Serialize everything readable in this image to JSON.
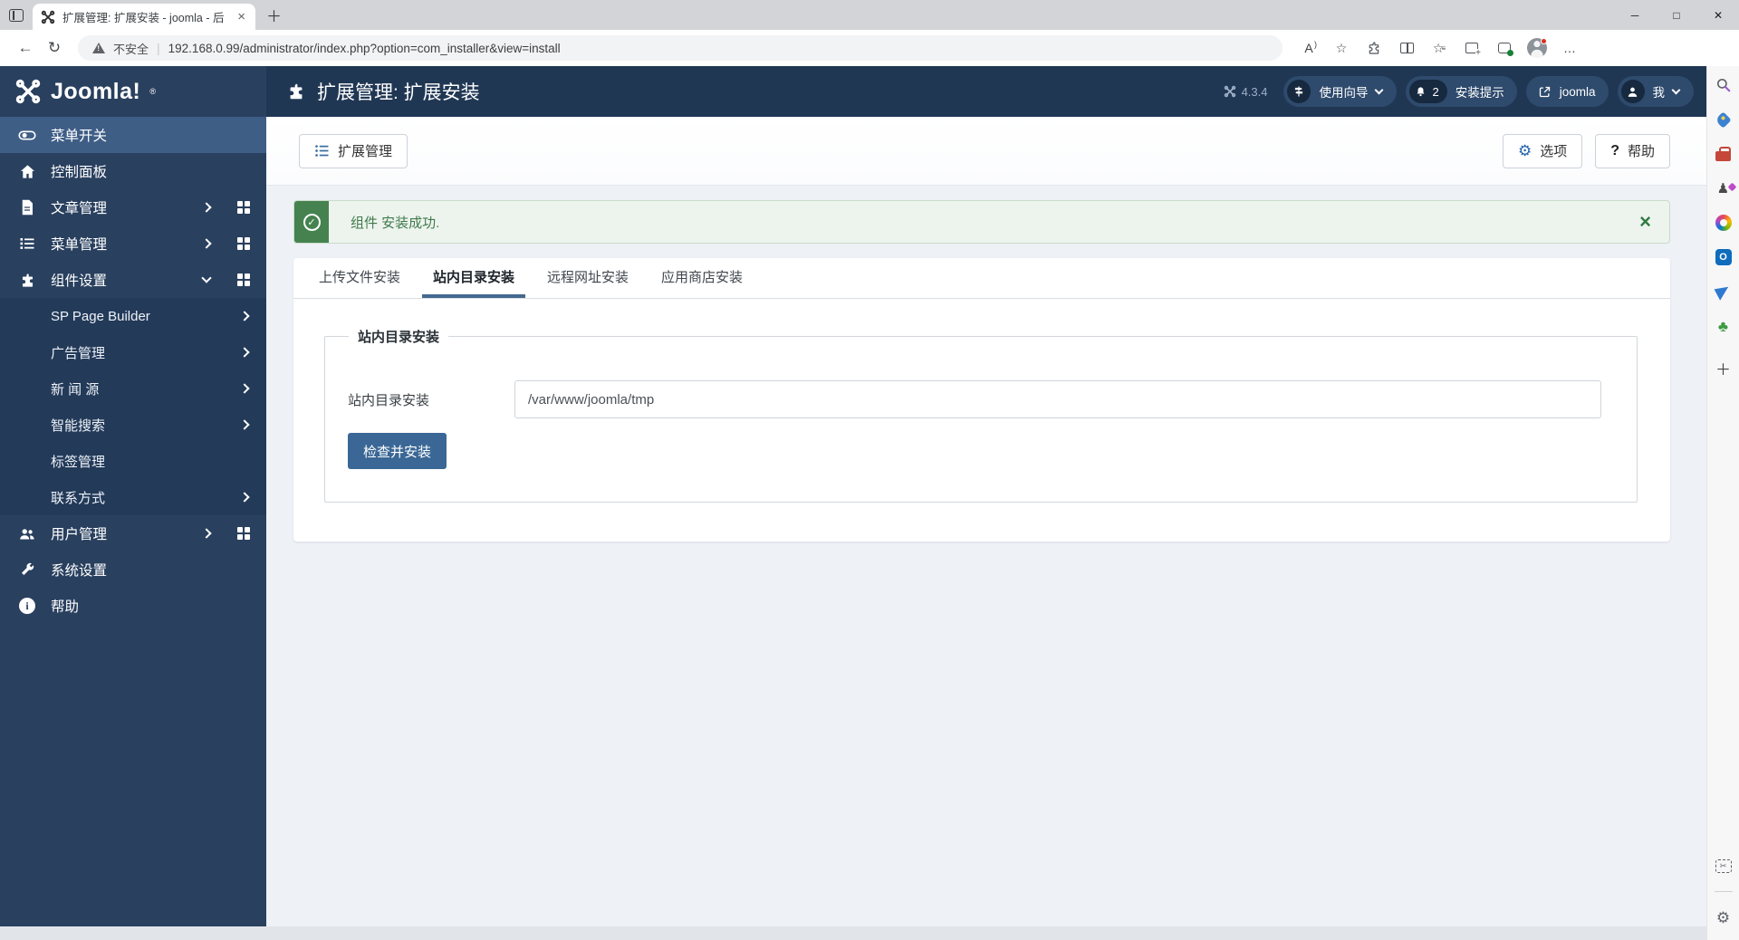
{
  "browser": {
    "tab": {
      "title": "扩展管理: 扩展安装 - joomla - 后",
      "close_glyph": "×"
    },
    "new_tab_glyph": "＋",
    "window_controls": {
      "minimize_glyph": "─",
      "maximize_glyph": "□",
      "close_glyph": "✕"
    },
    "nav": {
      "back_glyph": "←",
      "refresh_glyph": "↻",
      "security_label": "不安全",
      "divider_glyph": "|",
      "url": "192.168.0.99/administrator/index.php?option=com_installer&view=install",
      "read_aloud_glyph": "A",
      "favorite_glyph": "☆",
      "favorites_bar_glyph": "☆",
      "favorites_bar_lines": "≡",
      "more_glyph": "…"
    }
  },
  "app_header": {
    "title": "扩展管理: 扩展安装",
    "version": "4.3.4",
    "pills": [
      {
        "label": "使用向导"
      },
      {
        "label": "安装提示",
        "badge": "2"
      },
      {
        "label": "joomla"
      },
      {
        "label": "我"
      }
    ]
  },
  "sidebar": {
    "logo_text": "Joomla!",
    "logo_reg": "®",
    "items": [
      {
        "label": "菜单开关"
      },
      {
        "label": "控制面板"
      },
      {
        "label": "文章管理"
      },
      {
        "label": "菜单管理"
      },
      {
        "label": "组件设置"
      },
      {
        "label": "用户管理"
      },
      {
        "label": "系统设置"
      },
      {
        "label": "帮助"
      }
    ],
    "subitems": [
      {
        "label": "SP Page Builder"
      },
      {
        "label": "广告管理"
      },
      {
        "label": "新 闻 源"
      },
      {
        "label": "智能搜索"
      },
      {
        "label": "标签管理"
      },
      {
        "label": "联系方式"
      }
    ]
  },
  "toolbar": {
    "manager_label": "扩展管理",
    "options_label": "选项",
    "options_glyph": "⚙",
    "help_label": "帮助",
    "help_glyph": "?"
  },
  "alert": {
    "check_glyph": "✓",
    "message": "组件 安装成功.",
    "close_glyph": "×"
  },
  "tabs": {
    "items": [
      {
        "label": "上传文件安装"
      },
      {
        "label": "站内目录安装"
      },
      {
        "label": "远程网址安装"
      },
      {
        "label": "应用商店安装"
      }
    ]
  },
  "form": {
    "legend": "站内目录安装",
    "field_label": "站内目录安装",
    "field_value": "/var/www/joomla/tmp",
    "submit_label": "检查并安装"
  },
  "edge_sidebar": {
    "games_glyph": "♟",
    "tree_glyph": "♣",
    "add_glyph": "＋",
    "snip_glyph": "✂",
    "settings_glyph": "⚙",
    "outlook_letter": "O"
  },
  "colors": {
    "header_bg": "#203754",
    "sidebar_bg": "#29405f",
    "active_item_bg": "#3f5e86",
    "accent_blue": "#3a6795",
    "success_green": "#45824f",
    "tab_underline": "#44688f"
  }
}
